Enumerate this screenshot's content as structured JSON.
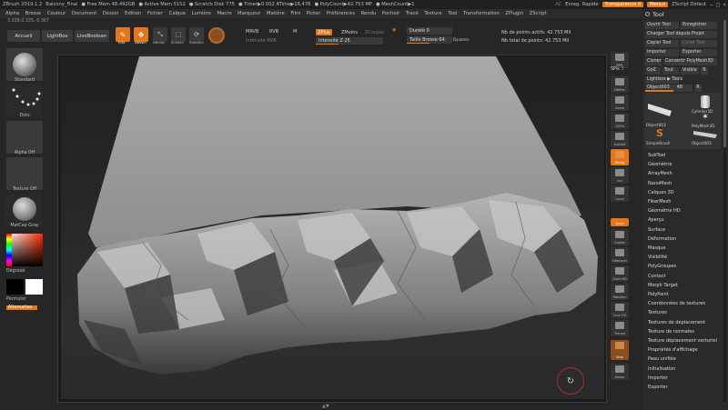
{
  "titlebar": {
    "app": "ZBrush 2019.1.2",
    "file": "Balcony_Final",
    "free_mem": "● Free Mem 48.492GB",
    "active_mem": "● Active Mem 5152",
    "scratch_disk": "● Scratch Disk 775",
    "timer": "● Timer▶0.002 ATime▶16.476",
    "polycount": "● PolyCount▶42.753 MP",
    "meshcount": "● MeshCount▶1",
    "ac": "AC",
    "quicksave": "Enreg. Rapide",
    "transparency": "Transparence 0",
    "menus": "Menus",
    "zscript": "ZScript Défaut",
    "win_controls": "– □ ×"
  },
  "menubar": [
    "Alpha",
    "Brosse",
    "Couleur",
    "Document",
    "Dessin",
    "Edition",
    "Fichier",
    "Calque",
    "Lumière",
    "Macro",
    "Marqueur",
    "Matière",
    "Film",
    "Picker",
    "Préférences",
    "Rendu",
    "Pochoir",
    "Tracé",
    "Texture",
    "Tool",
    "Transformation",
    "ZPlugin",
    "ZScript"
  ],
  "coords": "3.038,0.335,-0.367",
  "shelf": {
    "home": "Accueil",
    "lightbox": "LightBox",
    "liveboolean": "LiveBoolean",
    "edit": "Edit",
    "draw": "Dessin",
    "move": "Déplac.",
    "scale": "Echelle",
    "rotate": "Rotation",
    "mrgb": "MRVB",
    "rgb": "RVB",
    "m": "M",
    "rgb_intensity": "Intensité RVB",
    "zadd": "ZPlus",
    "zsub": "ZMoins",
    "zcut": "ZCouper",
    "z_intensity": "Intensité Z 25",
    "focal": "Dureté 0",
    "draw_size": "Taille Brosse 64",
    "dynamic": "Dynamic",
    "active_points": "Nb de points actifs: 42.753 Mil",
    "total_points": "Nb total de points: 42.753 Mil"
  },
  "leftpanel": {
    "brush": "Standard",
    "stroke": "Dots",
    "alpha": "Alpha Off",
    "texture": "Texture Off",
    "material": "MatCap Gray",
    "gradient": "Dégradé",
    "switch": "Permuter",
    "alternate": "Alternative"
  },
  "dock": {
    "bpr": "BPR",
    "spix_label": "SPix",
    "spix_value": "3",
    "scroll": "Défiler",
    "zoom": "Zoom",
    "actual": "100%",
    "halfsize": "AAHalf",
    "persp": "Persp",
    "floor": "Sol",
    "local": "Local",
    "xyz": "Qxyz",
    "frame": "Cadrer",
    "move": "Déplacer",
    "scale": "Zoom3D",
    "rotate": "Rotation",
    "linefill": "Line Fill",
    "polyf": "PolyF",
    "transp": "Transp",
    "solo": "Solo",
    "xpose": "Xpose"
  },
  "palette": {
    "title": "Tool",
    "load_tool": "Ouvrir Tool",
    "save_as": "Enregistrer",
    "load_from_project": "Charger Tool depuis Projet",
    "copy_tool": "Copier Tool",
    "paste_tool": "Coller Tool",
    "import": "Importer",
    "export": "Exporter",
    "clone": "Cloner",
    "make_polymesh": "Convertir PolyMesh3D",
    "goz": "GoZ",
    "all": "Tout",
    "visible": "Visible",
    "r": "R",
    "lightbox_tools": "Lightbox ▶ Tools",
    "object_field": "Object003",
    "object_value": "48",
    "thumbs": [
      "Object003",
      "Cylinder3D",
      "PolyMesh3D",
      "SimpleBrush",
      "Object003"
    ],
    "subpalettes": [
      "SubTool",
      "Géométrie",
      "ArrayMesh",
      "NanoMesh",
      "Calques 3D",
      "FiberMesh",
      "Géométrie HD",
      "Aperçu",
      "Surface",
      "Déformation",
      "Masque",
      "Visibilité",
      "PolyGroupes",
      "Contact",
      "Morph Target",
      "PolyPaint",
      "Coordonnées de textures",
      "Textures",
      "Textures de déplacement",
      "Texture de normales",
      "Texture déplacement vectoriel",
      "Propriétés d'affichage",
      "Peau unifiée",
      "Initialisation",
      "Importer",
      "Exporter"
    ]
  },
  "canvas_hint": "▲▼",
  "colors": {
    "accent": "#e2761b",
    "bg": "#262626",
    "panel": "#2a2a2a"
  }
}
